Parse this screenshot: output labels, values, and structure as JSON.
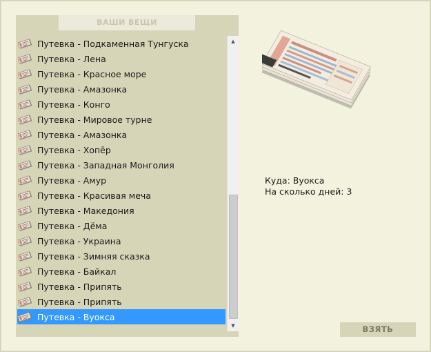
{
  "panel": {
    "title": "ВАШИ ВЕЩИ"
  },
  "items": [
    "Путевка - Подкаменная Тунгуска",
    "Путевка - Лена",
    "Путевка - Красное море",
    "Путевка - Амазонка",
    "Путевка - Конго",
    "Путевка - Мировое турне",
    "Путевка - Амазонка",
    "Путевка - Хопёр",
    "Путевка - Западная Монголия",
    "Путевка - Амур",
    "Путевка - Красивая меча",
    "Путевка - Македония",
    "Путевка - Дёма",
    "Путевка - Украина",
    "Путевка - Зимняя сказка",
    "Путевка - Байкал",
    "Путевка - Припять",
    "Путевка - Припять",
    "Путевка - Вуокса"
  ],
  "selected_index": 18,
  "details": {
    "destination_line": "Куда: Вуокса",
    "days_line": "На сколько дней: 3"
  },
  "take_button": "ВЗЯТЬ",
  "icons": {
    "item": "ticket-icon",
    "preview": "ticket-stack-image"
  },
  "colors": {
    "background": "#f2f1de",
    "panel": "#d6d5b8",
    "selection": "#3399ff"
  }
}
